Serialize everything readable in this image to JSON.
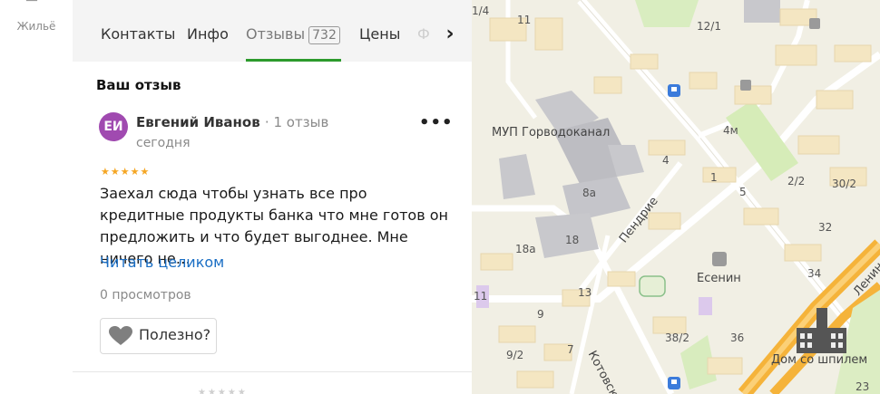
{
  "sidebar": {
    "items": [
      {
        "label": "Жильё",
        "icon": "house-icon"
      }
    ]
  },
  "panel": {
    "tabs": [
      {
        "label": "Контакты"
      },
      {
        "label": "Инфо"
      },
      {
        "label": "Отзывы",
        "badge": "732",
        "active": true
      },
      {
        "label": "Цены"
      }
    ],
    "tab_fade": "Ф",
    "next_arrow": "›"
  },
  "review_section": {
    "title": "Ваш отзыв",
    "avatar_initials": "ЕИ",
    "author": "Евгений Иванов",
    "author_count": "· 1 отзыв",
    "date": "сегодня",
    "more": "•••",
    "stars": "★★★★★",
    "rating": 5,
    "text": "Заехал сюда чтобы узнать все про кредитные продукты банка что мне готов он предложить и что будет выгоднее. Мне ничего не…",
    "read_more": "Читать целиком",
    "views": "0 просмотров",
    "useful_label": "Полезно?"
  },
  "map": {
    "labels": {
      "l1": "11",
      "l2": "12/1",
      "l3": "1/4",
      "l4": "4м",
      "l5": "МУП Горводоканал",
      "l6": "4",
      "l7": "1",
      "l8": "5",
      "l9": "8а",
      "l10": "2/2",
      "l11": "30/2",
      "l12": "18",
      "l13": "18а",
      "l14": "32",
      "l15": "Есенин",
      "l16": "34",
      "l17": "11",
      "l18": "13",
      "l19": "9",
      "l20": "38/2",
      "l21": "36",
      "l22": "9/2",
      "l23": "7",
      "l24": "Дом со шпилем",
      "l25": "23"
    },
    "streets": {
      "s1": "Пендрие",
      "s2": "Котовско",
      "s3": "Ленин"
    }
  }
}
